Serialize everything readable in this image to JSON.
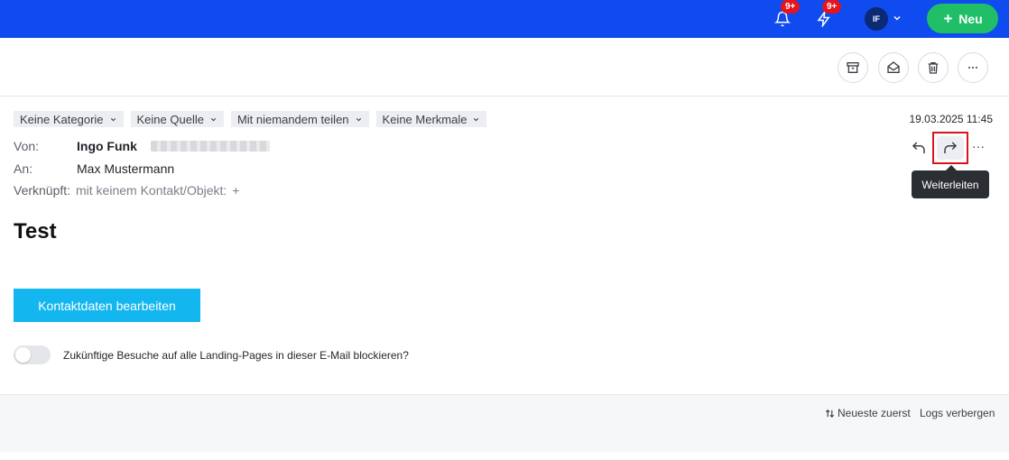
{
  "topbar": {
    "notifications_badge": "9+",
    "activity_badge": "9+",
    "avatar_initials": "IF",
    "new_button_label": "Neu",
    "accent": "#0f4bef",
    "new_button_color": "#1fbe67"
  },
  "tags": [
    "Keine Kategorie",
    "Keine Quelle",
    "Mit niemandem teilen",
    "Keine Merkmale"
  ],
  "email": {
    "date": "19.03.2025 11:45",
    "from_label": "Von:",
    "from_name": "Ingo Funk",
    "to_label": "An:",
    "to_name": "Max Mustermann",
    "linked_label": "Verknüpft:",
    "linked_value": "mit keinem Kontakt/Objekt:",
    "linked_add": "+",
    "subject": "Test",
    "cta_label": "Kontaktdaten bearbeiten",
    "more_label": "···"
  },
  "tooltip": "Weiterleiten",
  "toggle": {
    "label": "Zukünftige Besuche auf alle Landing-Pages in dieser E-Mail blockieren?",
    "checked": false
  },
  "footer": {
    "sort_label": "Neueste zuerst",
    "logs_label": "Logs verbergen"
  },
  "icons": {
    "bell": "bell-icon",
    "bolt": "bolt-icon",
    "archive": "archive-icon",
    "mark_read": "envelope-open-icon",
    "delete": "trash-icon",
    "more": "more-icon",
    "reply": "reply-icon",
    "forward": "forward-icon"
  }
}
